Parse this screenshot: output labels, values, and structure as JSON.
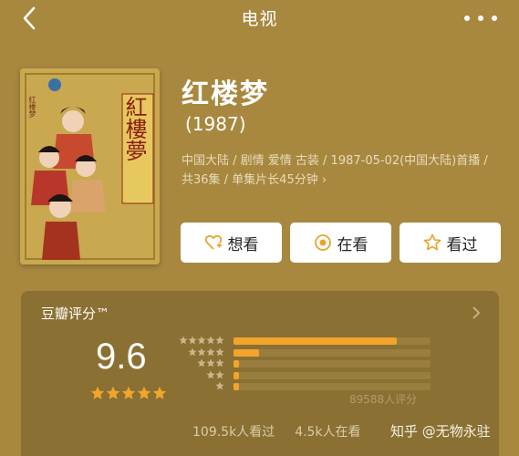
{
  "nav": {
    "title": "电视"
  },
  "show": {
    "title": "红楼梦",
    "year": "(1987)",
    "meta": "中国大陆 / 剧情 爱情 古装 / 1987-05-02(中国大陆)首播 / 共36集 / 单集片长45分钟 ›",
    "poster_text": "紅樓夢",
    "poster_badge": "红楼梦"
  },
  "actions": [
    {
      "label": "想看",
      "icon": "heart-plus-icon"
    },
    {
      "label": "在看",
      "icon": "target-icon"
    },
    {
      "label": "看过",
      "icon": "star-outline-icon"
    }
  ],
  "rating": {
    "title": "豆瓣评分™",
    "score": "9.6",
    "star_level": 5,
    "distribution": [
      0.83,
      0.13,
      0.03,
      0.01,
      0.01
    ],
    "raters": "89588人评分",
    "wish": "109.5k人看过",
    "doing": "4.5k人在看",
    "accent": "#F3A52B"
  },
  "watermark": {
    "text": "知乎 @无物永驻"
  }
}
